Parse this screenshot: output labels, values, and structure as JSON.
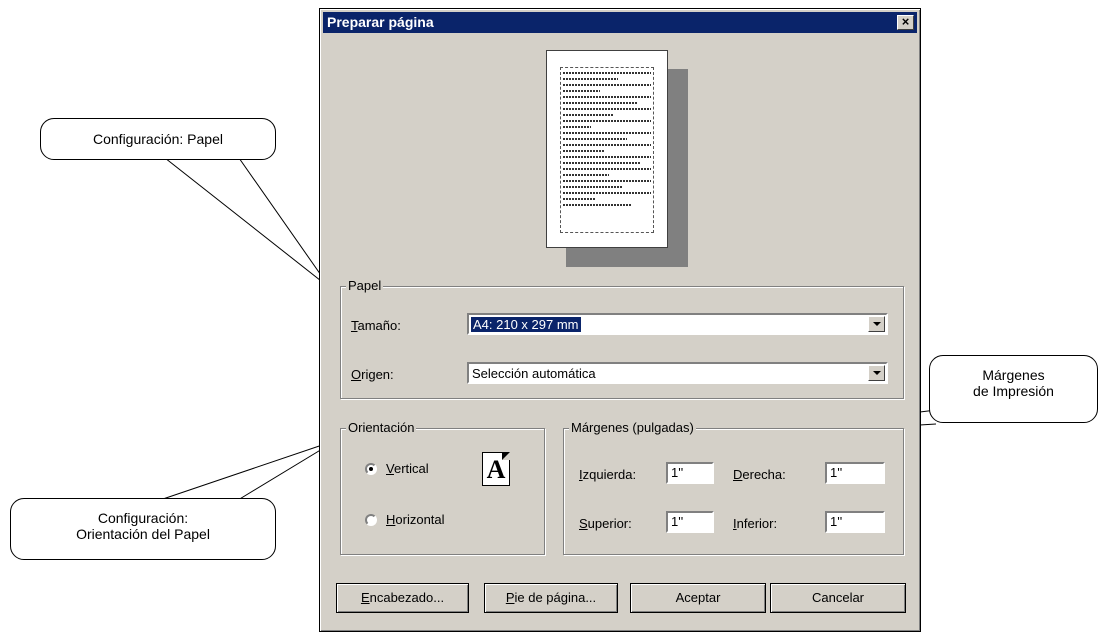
{
  "dialog": {
    "title": "Preparar página",
    "close_label": "×",
    "paper_group": {
      "legend": "Papel",
      "size_label_first": "T",
      "size_label_rest": "amaño:",
      "size_value": "A4: 210 x 297 mm",
      "source_label_first": "O",
      "source_label_rest": "rigen:",
      "source_value": "Selección automática"
    },
    "orientation_group": {
      "legend": "Orientación",
      "vertical_first": "V",
      "vertical_rest": "ertical",
      "horizontal_first": "H",
      "horizontal_rest": "orizontal",
      "selected": "vertical",
      "icon_letter": "A"
    },
    "margins_group": {
      "legend": "Márgenes (pulgadas)",
      "left_first": "I",
      "left_rest": "zquierda:",
      "left_value": "1''",
      "right_first": "D",
      "right_rest": "erecha:",
      "right_value": "1''",
      "top_first": "S",
      "top_rest": "uperior:",
      "top_value": "1''",
      "bottom_first": "I",
      "bottom_rest": "nferior:",
      "bottom_value": "1''"
    },
    "buttons": {
      "header_first": "E",
      "header_rest": "ncabezado...",
      "footer_first": "P",
      "footer_rest": "ie de página...",
      "accept": "Aceptar",
      "cancel": "Cancelar"
    }
  },
  "callouts": {
    "paper": "Configuración: Papel",
    "orientation_line1": "Configuración:",
    "orientation_line2": "Orientación del Papel",
    "margins_line1": "Márgenes",
    "margins_line2": "de Impresión"
  }
}
